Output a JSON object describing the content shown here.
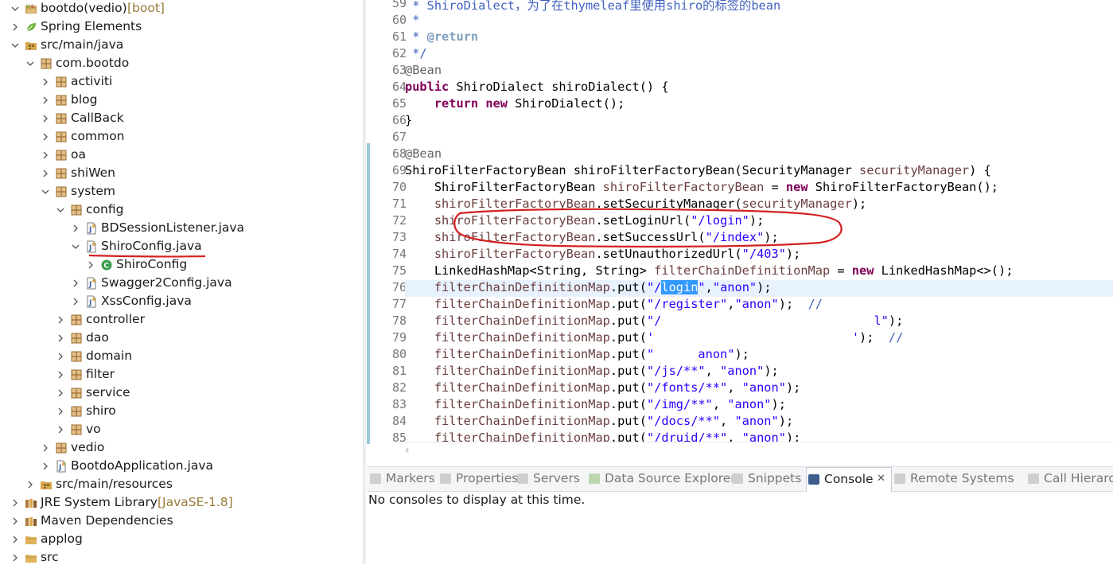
{
  "explorer": {
    "items": [
      {
        "label": "bootdo(vedio)",
        "decoration": " [boot]",
        "icon": "maven-project-icon",
        "chevron": "down"
      },
      {
        "label": "Spring Elements",
        "icon": "spring-leaf-icon",
        "chevron": "right"
      },
      {
        "label": "src/main/java",
        "icon": "source-folder-icon",
        "chevron": "down"
      },
      {
        "label": "com.bootdo",
        "icon": "package-icon",
        "chevron": "down"
      },
      {
        "label": "activiti",
        "icon": "package-icon",
        "chevron": "right"
      },
      {
        "label": "blog",
        "icon": "package-icon",
        "chevron": "right"
      },
      {
        "label": "CallBack",
        "icon": "package-icon",
        "chevron": "right"
      },
      {
        "label": "common",
        "icon": "package-icon",
        "chevron": "right"
      },
      {
        "label": "oa",
        "icon": "package-icon",
        "chevron": "right"
      },
      {
        "label": "shiWen",
        "icon": "package-icon",
        "chevron": "right"
      },
      {
        "label": "system",
        "icon": "package-icon",
        "chevron": "down"
      },
      {
        "label": "config",
        "icon": "package-icon",
        "chevron": "down"
      },
      {
        "label": "BDSessionListener.java",
        "icon": "java-file-icon",
        "chevron": "right"
      },
      {
        "label": "ShiroConfig.java",
        "icon": "java-file-icon",
        "chevron": "down",
        "selected": true
      },
      {
        "label": "ShiroConfig",
        "icon": "class-icon",
        "chevron": "right"
      },
      {
        "label": "Swagger2Config.java",
        "icon": "java-file-icon",
        "chevron": "right"
      },
      {
        "label": "XssConfig.java",
        "icon": "java-file-icon",
        "chevron": "right"
      },
      {
        "label": "controller",
        "icon": "package-icon",
        "chevron": "right"
      },
      {
        "label": "dao",
        "icon": "package-icon",
        "chevron": "right"
      },
      {
        "label": "domain",
        "icon": "package-icon",
        "chevron": "right"
      },
      {
        "label": "filter",
        "icon": "package-icon",
        "chevron": "right"
      },
      {
        "label": "service",
        "icon": "package-icon",
        "chevron": "right"
      },
      {
        "label": "shiro",
        "icon": "package-icon",
        "chevron": "right"
      },
      {
        "label": "vo",
        "icon": "package-icon",
        "chevron": "right"
      },
      {
        "label": "vedio",
        "icon": "package-icon",
        "chevron": "right"
      },
      {
        "label": "BootdoApplication.java",
        "icon": "java-file-icon",
        "chevron": "right"
      },
      {
        "label": "src/main/resources",
        "icon": "source-folder-icon",
        "chevron": "right"
      },
      {
        "label": "JRE System Library",
        "decoration": " [JavaSE-1.8]",
        "icon": "library-icon",
        "chevron": "right"
      },
      {
        "label": "Maven Dependencies",
        "icon": "library-icon",
        "chevron": "right"
      },
      {
        "label": "applog",
        "icon": "folder-icon",
        "chevron": "right"
      },
      {
        "label": "src",
        "icon": "folder-icon",
        "chevron": "right"
      }
    ]
  },
  "editor": {
    "line_numbers": [
      "59",
      "60",
      "61",
      "62",
      "63",
      "64",
      "65",
      "66",
      "67",
      "68",
      "69",
      "70",
      "71",
      "72",
      "73",
      "74",
      "75",
      "76",
      "77",
      "78",
      "79",
      "80",
      "81",
      "82",
      "83",
      "84",
      "85"
    ],
    "code": {
      "l59": [
        " * ShiroDialect，为了在thymeleaf里使用shiro的标签的bean"
      ],
      "l60": [
        " *"
      ],
      "l61": [
        " * ",
        "@return"
      ],
      "l62": [
        " */"
      ],
      "l63": [
        "@Bean"
      ],
      "l64": [
        "public",
        " ShiroDialect shiroDialect() {"
      ],
      "l65": [
        "    ",
        "return",
        " ",
        "new",
        " ShiroDialect();"
      ],
      "l66": [
        "}"
      ],
      "l67": [
        ""
      ],
      "l68": [
        "@Bean"
      ],
      "l69": [
        "ShiroFilterFactoryBean shiroFilterFactoryBean(SecurityManager ",
        "securityManager",
        ") {"
      ],
      "l70": [
        "    ShiroFilterFactoryBean ",
        "shiroFilterFactoryBean",
        " = ",
        "new",
        " ShiroFilterFactoryBean();"
      ],
      "l71": [
        "    ",
        "shiroFilterFactoryBean",
        ".setSecurityManager(",
        "securityManager",
        ");"
      ],
      "l72": [
        "    ",
        "shiroFilterFactoryBean",
        ".setLoginUrl(",
        "\"/login\"",
        ");"
      ],
      "l73": [
        "    ",
        "shiroFilterFactoryBean",
        ".setSuccessUrl(",
        "\"/index\"",
        ");"
      ],
      "l74": [
        "    ",
        "shiroFilterFactoryBean",
        ".setUnauthorizedUrl(",
        "\"/403\"",
        ");"
      ],
      "l75": [
        "    LinkedHashMap<String, String> ",
        "filterChainDefinitionMap",
        " = ",
        "new",
        " LinkedHashMap<>();"
      ],
      "l76": [
        "    ",
        "filterChainDefinitionMap",
        ".put(",
        "\"/",
        "login",
        "\"",
        ",",
        "\"anon\"",
        ");"
      ],
      "l77": [
        "    ",
        "filterChainDefinitionMap",
        ".put(",
        "\"/register\"",
        ",",
        "\"anon\"",
        ");  ",
        "//"
      ],
      "l78": [
        "    ",
        "filterChainDefinitionMap",
        ".put(",
        "\"/",
        "                             ",
        "l\"",
        ");"
      ],
      "l79": [
        "    ",
        "filterChainDefinitionMap",
        ".put(",
        "'",
        "                           ",
        "'",
        ");  ",
        "//"
      ],
      "l80": [
        "    ",
        "filterChainDefinitionMap",
        ".put(",
        "\"",
        "      ",
        "anon\"",
        ");"
      ],
      "l81": [
        "    ",
        "filterChainDefinitionMap",
        ".put(",
        "\"/js/**\"",
        ", ",
        "\"anon\"",
        ");"
      ],
      "l82": [
        "    ",
        "filterChainDefinitionMap",
        ".put(",
        "\"/fonts/**\"",
        ", ",
        "\"anon\"",
        ");"
      ],
      "l83": [
        "    ",
        "filterChainDefinitionMap",
        ".put(",
        "\"/img/**\"",
        ", ",
        "\"anon\"",
        ");"
      ],
      "l84": [
        "    ",
        "filterChainDefinitionMap",
        ".put(",
        "\"/docs/**\"",
        ", ",
        "\"anon\"",
        ");"
      ],
      "l85": [
        "    ",
        "filterChainDefinitionMap",
        ".put(",
        "\"/druid/**\"",
        ", ",
        "\"anon\"",
        ");"
      ]
    }
  },
  "bottom_panel": {
    "tabs": [
      {
        "label": "Markers",
        "icon": "markers-icon"
      },
      {
        "label": "Properties",
        "icon": "properties-icon"
      },
      {
        "label": "Servers",
        "icon": "servers-icon"
      },
      {
        "label": "Data Source Explorer",
        "icon": "data-source-icon"
      },
      {
        "label": "Snippets",
        "icon": "snippets-icon"
      },
      {
        "label": "Console",
        "icon": "console-icon",
        "active": true
      },
      {
        "label": "Remote Systems",
        "icon": "remote-systems-icon"
      },
      {
        "label": "Call Hierarchy",
        "icon": "call-hierarchy-icon"
      }
    ],
    "close_glyph": "✕",
    "console_message": "No consoles to display at this time."
  },
  "colors": {
    "annotation_red": "#d42020",
    "keyword": "#7f0055",
    "string": "#2a00ff",
    "field": "#6a3e3e",
    "current_line": "#e8f2fe",
    "selection": "#3399ff"
  }
}
